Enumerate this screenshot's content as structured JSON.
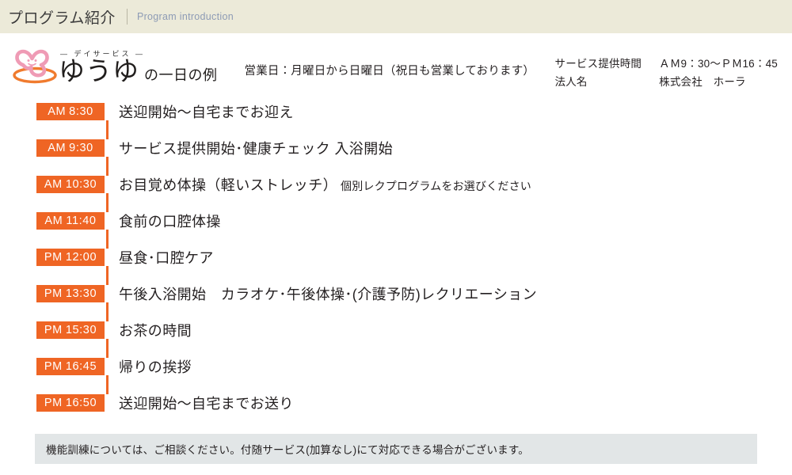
{
  "header": {
    "title": "プログラム紹介",
    "subtitle": "Program introduction",
    "band_color": "#ECEAD9",
    "subtitle_color": "#8D9BB5"
  },
  "logo": {
    "kicker": "— デイサービス —",
    "name": "ゆうゆ",
    "suffix": "の一日の例",
    "mark_icon": "mascot-flower-icon",
    "mark_colors": {
      "figure": "#EF9BB5",
      "base": "#F07B2E"
    }
  },
  "facility": {
    "business_days": "営業日：月曜日から日曜日（祝日も営業しております）",
    "rows": [
      {
        "label": "サービス提供時間",
        "value": "ＡＭ9：30〜ＰＭ16：45"
      },
      {
        "label": "法人名",
        "value": "株式会社　ホーラ"
      }
    ]
  },
  "schedule": {
    "accent_color": "#EF6524",
    "items": [
      {
        "ampm": "AM",
        "time": "8:30",
        "activity": "送迎開始〜自宅までお迎え",
        "note": ""
      },
      {
        "ampm": "AM",
        "time": "9:30",
        "activity": "サービス提供開始･健康チェック 入浴開始",
        "note": ""
      },
      {
        "ampm": "AM",
        "time": "10:30",
        "activity": "お目覚め体操（軽いストレッチ）",
        "note": "個別レクプログラムをお選びください"
      },
      {
        "ampm": "AM",
        "time": "11:40",
        "activity": "食前の口腔体操",
        "note": ""
      },
      {
        "ampm": "PM",
        "time": "12:00",
        "activity": "昼食･口腔ケア",
        "note": ""
      },
      {
        "ampm": "PM",
        "time": "13:30",
        "activity": "午後入浴開始　カラオケ･午後体操･(介護予防)レクリエーション",
        "note": ""
      },
      {
        "ampm": "PM",
        "time": "15:30",
        "activity": "お茶の時間",
        "note": ""
      },
      {
        "ampm": "PM",
        "time": "16:45",
        "activity": "帰りの挨拶",
        "note": ""
      },
      {
        "ampm": "PM",
        "time": "16:50",
        "activity": "送迎開始〜自宅までお送り",
        "note": ""
      }
    ]
  },
  "footer": {
    "note": "機能訓練については、ご相談ください。付随サービス(加算なし)にて対応できる場合がございます。",
    "background_color": "#E2E6E7"
  }
}
